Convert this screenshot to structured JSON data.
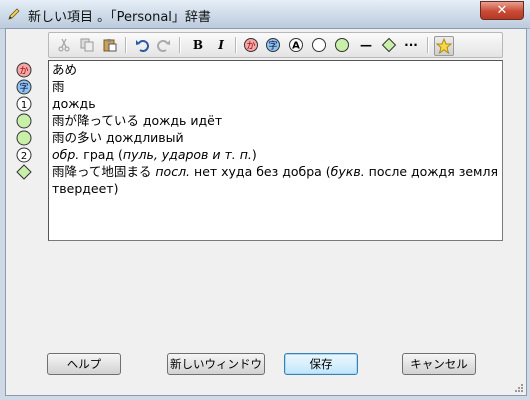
{
  "window": {
    "title": "新しい項目 。「Personal」辞書",
    "close_label": "✕"
  },
  "toolbar": {
    "bold_label": "B",
    "italic_label": "I",
    "circle_a_label": "A",
    "dash_label": "—",
    "dots_label": "···"
  },
  "markers": {
    "m1": "か",
    "m2": "字",
    "m3": "1",
    "m6": "2"
  },
  "entry": {
    "line1": "あめ",
    "line2": "雨",
    "line3": "дождь",
    "line4": "雨が降っている дождь идёт",
    "line5_jp": "雨の多い",
    "line5_ru": "дождливый",
    "line6_obr": "обр.",
    "line6_a": "град (",
    "line6_it": "пуль, ударов и т. п.",
    "line6_b": ")",
    "line7_jp": "雨降って地固まる",
    "line7_posl": "посл.",
    "line7_a": "нет худа без добра (",
    "line7_bukv": "букв.",
    "line7_b": "после дождя земля",
    "line8": "твердеет)"
  },
  "buttons": {
    "help": "ヘルプ",
    "new_window": "新しいウィンドウ",
    "save": "保存",
    "cancel": "キャンセル"
  },
  "colors": {
    "kana_marker": "#f4a7a7",
    "kanji_marker": "#8fc3f0",
    "green_circle": "#c8f0a8",
    "default_button_border": "#3c7fb1"
  }
}
